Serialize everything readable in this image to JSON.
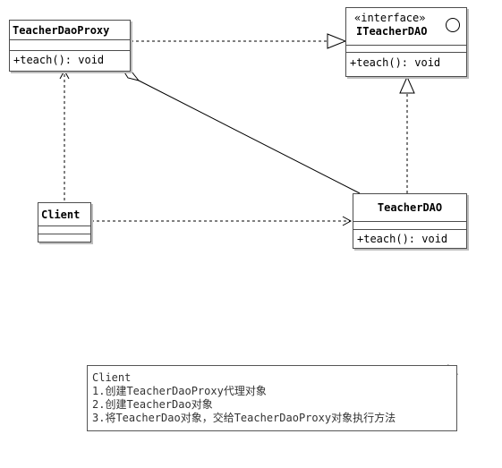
{
  "classes": {
    "proxy": {
      "name": "TeacherDaoProxy",
      "operation": "+teach(): void"
    },
    "iface": {
      "stereotype": "«interface»",
      "name": "ITeacherDAO",
      "operation": "+teach(): void"
    },
    "client": {
      "name": "Client"
    },
    "dao": {
      "name": "TeacherDAO",
      "operation": "+teach(): void"
    }
  },
  "note": {
    "lines": [
      "Client",
      "1.创建TeacherDaoProxy代理对象",
      "2.创建TeacherDao对象",
      "3.将TeacherDao对象，交给TeacherDaoProxy对象执行方法"
    ]
  },
  "relations": [
    {
      "from": "TeacherDaoProxy",
      "to": "ITeacherDAO",
      "kind": "realization"
    },
    {
      "from": "TeacherDAO",
      "to": "ITeacherDAO",
      "kind": "realization"
    },
    {
      "from": "TeacherDaoProxy",
      "to": "TeacherDAO",
      "kind": "aggregation"
    },
    {
      "from": "Client",
      "to": "TeacherDaoProxy",
      "kind": "dependency"
    },
    {
      "from": "Client",
      "to": "TeacherDAO",
      "kind": "dependency"
    }
  ],
  "colors": {
    "border": "#4d4d4d",
    "shadow": "#bdbdbd",
    "line": "#000000"
  }
}
